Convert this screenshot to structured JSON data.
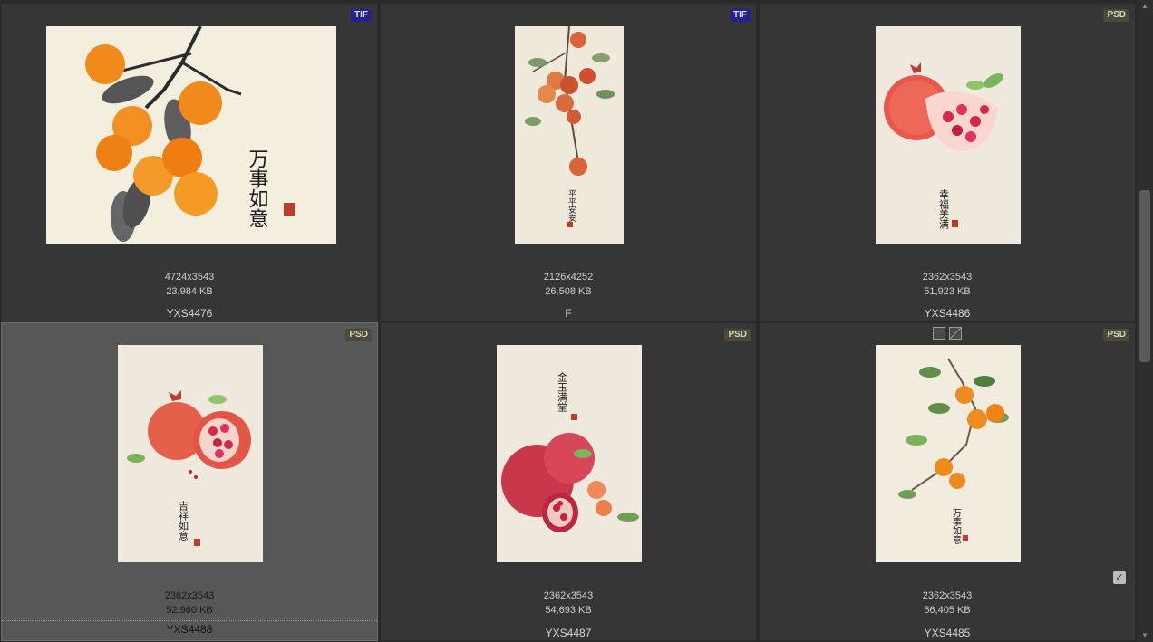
{
  "items": [
    {
      "badge": "TIF",
      "dims": "4724x3543",
      "size": "23,984 KB",
      "name": "YXS4476",
      "caption": "万事如意"
    },
    {
      "badge": "TIF",
      "dims": "2126x4252",
      "size": "26,508 KB",
      "name": "F",
      "caption": "平平安安"
    },
    {
      "badge": "PSD",
      "dims": "2362x3543",
      "size": "51,923 KB",
      "name": "YXS4486",
      "caption": "幸福美满"
    },
    {
      "badge": "PSD",
      "dims": "2362x3543",
      "size": "52,960 KB",
      "name": "YXS4488",
      "caption": "吉祥如意"
    },
    {
      "badge": "PSD",
      "dims": "2362x3543",
      "size": "54,693 KB",
      "name": "YXS4487",
      "caption": "金玉满堂"
    },
    {
      "badge": "PSD",
      "dims": "2362x3543",
      "size": "56,405 KB",
      "name": "YXS4485",
      "caption": "万事如意"
    }
  ],
  "icons": {
    "scroll_up": "chevron-up-icon",
    "scroll_down": "chevron-down-icon",
    "checkbox": "check-icon"
  },
  "colors": {
    "tif_badge": "#23238a",
    "psd_badge": "#4d4a3b",
    "selected_cell": "#575757"
  }
}
